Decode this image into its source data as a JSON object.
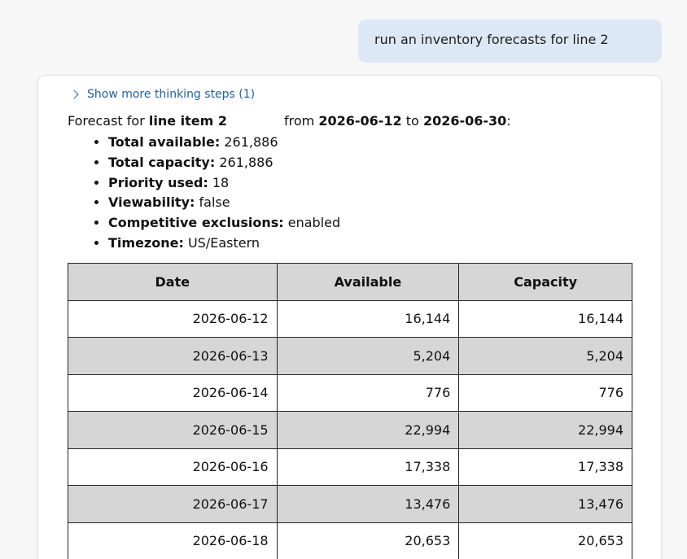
{
  "user_message": "run an inventory forecasts for line 2",
  "thinking": {
    "label": "Show more thinking steps (1)"
  },
  "intro": {
    "prefix": "Forecast for ",
    "line_item": "line item 2",
    "from_word": "from",
    "start_date": "2026-06-12",
    "to_word": "to",
    "end_date": "2026-06-30",
    "suffix": ":"
  },
  "facts": [
    {
      "label": "Total available:",
      "value": "261,886"
    },
    {
      "label": "Total capacity:",
      "value": "261,886"
    },
    {
      "label": "Priority used:",
      "value": "18"
    },
    {
      "label": "Viewability:",
      "value": "false"
    },
    {
      "label": "Competitive exclusions:",
      "value": "enabled"
    },
    {
      "label": "Timezone:",
      "value": "US/Eastern"
    }
  ],
  "table": {
    "headers": [
      "Date",
      "Available",
      "Capacity"
    ],
    "rows": [
      [
        "2026-06-12",
        "16,144",
        "16,144"
      ],
      [
        "2026-06-13",
        "5,204",
        "5,204"
      ],
      [
        "2026-06-14",
        "776",
        "776"
      ],
      [
        "2026-06-15",
        "22,994",
        "22,994"
      ],
      [
        "2026-06-16",
        "17,338",
        "17,338"
      ],
      [
        "2026-06-17",
        "13,476",
        "13,476"
      ],
      [
        "2026-06-18",
        "20,653",
        "20,653"
      ]
    ]
  },
  "colors": {
    "user_bubble": "#dde8f6",
    "link": "#1f5fa6",
    "table_stripe": "#d6d6d6"
  }
}
